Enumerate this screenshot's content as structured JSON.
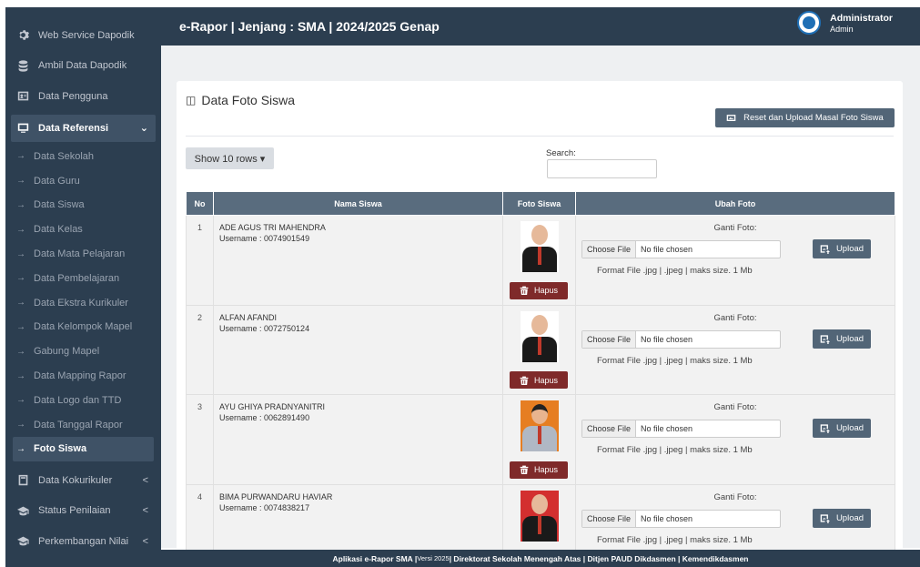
{
  "sidebar": {
    "top_items": [
      {
        "label": "Web Service Dapodik",
        "icon": "gear-icon"
      },
      {
        "label": "Ambil Data Dapodik",
        "icon": "database-icon"
      },
      {
        "label": "Data Pengguna",
        "icon": "user-card-icon"
      }
    ],
    "active_group": {
      "label": "Data Referensi",
      "icon": "monitor-icon"
    },
    "sub_items": [
      "Data Sekolah",
      "Data Guru",
      "Data Siswa",
      "Data Kelas",
      "Data Mata Pelajaran",
      "Data Pembelajaran",
      "Data Ekstra Kurikuler",
      "Data Kelompok Mapel",
      "Gabung Mapel",
      "Data Mapping Rapor",
      "Data Logo dan TTD",
      "Data Tanggal Rapor"
    ],
    "active_sub": "Foto Siswa",
    "bottom_items": [
      {
        "label": "Data Kokurikuler",
        "icon": "book-icon"
      },
      {
        "label": "Status Penilaian",
        "icon": "graduation-icon"
      },
      {
        "label": "Perkembangan Nilai",
        "icon": "graduation-icon"
      }
    ]
  },
  "header": {
    "title": "e-Rapor | Jenjang : SMA | 2024/2025 Genap",
    "user_name": "Administrator",
    "user_role": "Admin"
  },
  "page": {
    "title": "Data Foto Siswa",
    "reset_button": "Reset dan Upload Masal Foto Siswa",
    "show_rows": "Show 10 rows ▾",
    "search_label": "Search:",
    "search_value": ""
  },
  "table": {
    "headers": [
      "No",
      "Nama Siswa",
      "Foto Siswa",
      "Ubah Foto"
    ],
    "rows": [
      {
        "no": "1",
        "name": "ADE AGUS TRI MAHENDRA",
        "username": "Username : 0074901549",
        "photo": "boy"
      },
      {
        "no": "2",
        "name": "ALFAN AFANDI",
        "username": "Username : 0072750124",
        "photo": "boy"
      },
      {
        "no": "3",
        "name": "AYU GHIYA PRADNYANITRI",
        "username": "Username : 0062891490",
        "photo": "girl"
      },
      {
        "no": "4",
        "name": "BIMA PURWANDARU HAVIAR",
        "username": "Username : 0074838217",
        "photo": "red"
      }
    ],
    "hapus_label": "Hapus",
    "ganti_label": "Ganti Foto:",
    "choose_file": "Choose File",
    "no_file": "No file chosen",
    "format_text": "Format File .jpg | .jpeg | maks size. 1 Mb",
    "upload_label": "Upload"
  },
  "footer": {
    "text_a": "Aplikasi e-Rapor SMA | ",
    "version": "Versi 2025",
    "text_b": " | Direktorat Sekolah Menengah Atas | Ditjen PAUD Dikdasmen | Kemendikdasmen"
  }
}
